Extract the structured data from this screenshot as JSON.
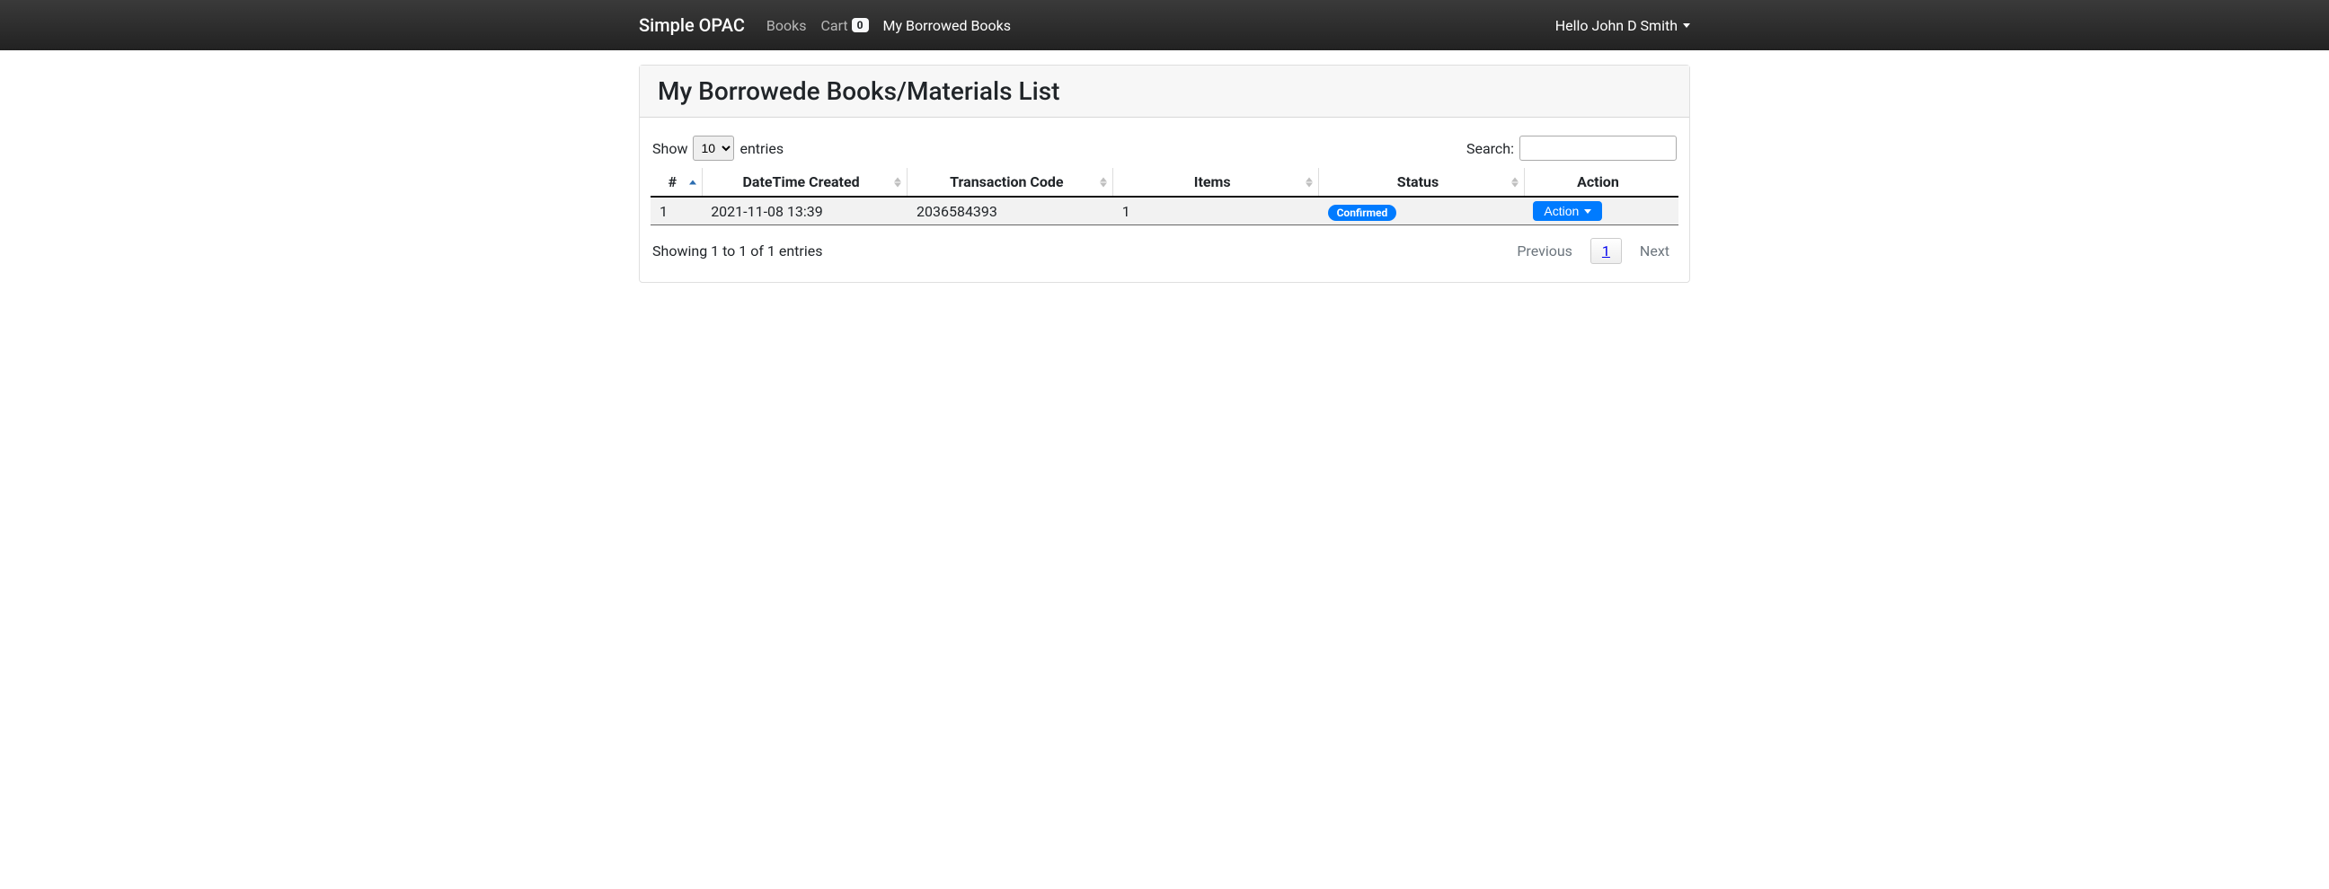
{
  "nav": {
    "brand": "Simple OPAC",
    "books": "Books",
    "cart_label": "Cart",
    "cart_count": "0",
    "borrowed": "My Borrowed Books",
    "greeting": "Hello John D Smith"
  },
  "page": {
    "title": "My Borrowede Books/Materials List"
  },
  "dt": {
    "show_label": "Show",
    "entries_label": "entries",
    "length_value": "10",
    "search_label": "Search:",
    "search_value": "",
    "info": "Showing 1 to 1 of 1 entries",
    "prev": "Previous",
    "next": "Next",
    "page_num": "1"
  },
  "headers": {
    "index": "#",
    "datetime": "DateTime Created",
    "code": "Transaction Code",
    "items": "Items",
    "status": "Status",
    "action": "Action"
  },
  "row": {
    "index": "1",
    "datetime": "2021-11-08 13:39",
    "code": "2036584393",
    "items": "1",
    "status": "Confirmed",
    "action": "Action"
  }
}
